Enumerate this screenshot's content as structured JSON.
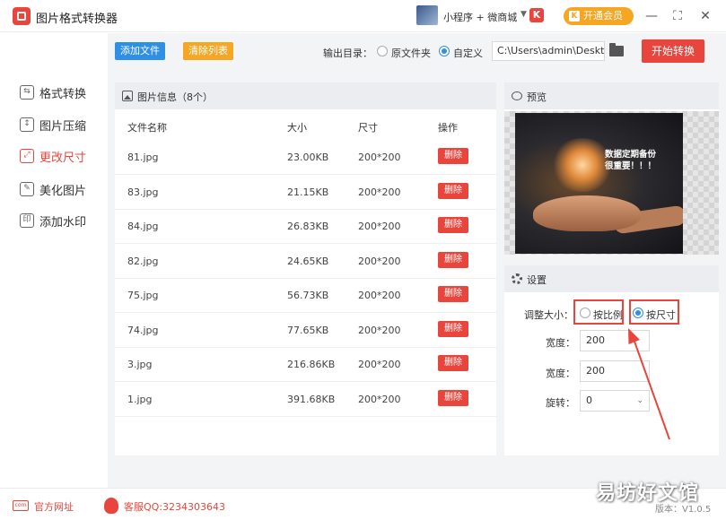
{
  "app": {
    "title": "图片格式转换器",
    "mini_program_label": "小程序 + 微商城",
    "k_logo": "K",
    "vip_label": "开通会员",
    "vip_icon": "K",
    "window_controls": [
      "—",
      "⛶",
      "✕"
    ]
  },
  "sidebar": {
    "items": [
      {
        "label": "格式转换",
        "icon": "format-convert-icon",
        "glyph": "⇆",
        "active": false
      },
      {
        "label": "图片压缩",
        "icon": "compress-icon",
        "glyph": "↕",
        "active": false
      },
      {
        "label": "更改尺寸",
        "icon": "resize-icon",
        "glyph": "⤢",
        "active": true
      },
      {
        "label": "美化图片",
        "icon": "beautify-icon",
        "glyph": "✎",
        "active": false
      },
      {
        "label": "添加水印",
        "icon": "watermark-icon",
        "glyph": "印",
        "active": false
      }
    ]
  },
  "toolbar": {
    "add_file": "添加文件",
    "clear_list": "清除列表",
    "output_label": "输出目录：",
    "option_original": "原文件夹",
    "option_custom": "自定义",
    "selected_option": "自定义",
    "path_value": "C:\\Users\\admin\\Deskto",
    "start_button": "开始转换"
  },
  "file_panel": {
    "title": "图片信息（8个）",
    "columns": [
      "文件名称",
      "大小",
      "尺寸",
      "操作"
    ],
    "rows": [
      {
        "name": "81.jpg",
        "size": "23.00KB",
        "dims": "200*200",
        "action": "删除"
      },
      {
        "name": "83.jpg",
        "size": "21.15KB",
        "dims": "200*200",
        "action": "删除"
      },
      {
        "name": "84.jpg",
        "size": "26.83KB",
        "dims": "200*200",
        "action": "删除"
      },
      {
        "name": "82.jpg",
        "size": "24.65KB",
        "dims": "200*200",
        "action": "删除"
      },
      {
        "name": "75.jpg",
        "size": "56.73KB",
        "dims": "200*200",
        "action": "删除"
      },
      {
        "name": "74.jpg",
        "size": "77.65KB",
        "dims": "200*200",
        "action": "删除"
      },
      {
        "name": "3.jpg",
        "size": "216.86KB",
        "dims": "200*200",
        "action": "删除"
      },
      {
        "name": "1.jpg",
        "size": "391.68KB",
        "dims": "200*200",
        "action": "删除"
      }
    ]
  },
  "preview": {
    "title": "预览",
    "image_caption_line1": "数据定期备份",
    "image_caption_line2": "很重要！！！"
  },
  "settings": {
    "title": "设置",
    "adjust_label": "调整大小：",
    "option_ratio": "按比例",
    "option_size": "按尺寸",
    "selected_option": "按尺寸",
    "width_label": "宽度：",
    "width_value": "200",
    "height_label": "宽度：",
    "height_value": "200",
    "rotate_label": "旋转：",
    "rotate_value": "0"
  },
  "footer": {
    "website_label": "官方网址",
    "website_icon_text": "com",
    "qq_label": "客服QQ:3234303643",
    "version_label": "版本：V1.0.5"
  },
  "watermark": "易坊好文馆",
  "colors": {
    "accent_red": "#e8453c",
    "accent_blue": "#2f8fe3",
    "accent_orange": "#f5a623"
  }
}
